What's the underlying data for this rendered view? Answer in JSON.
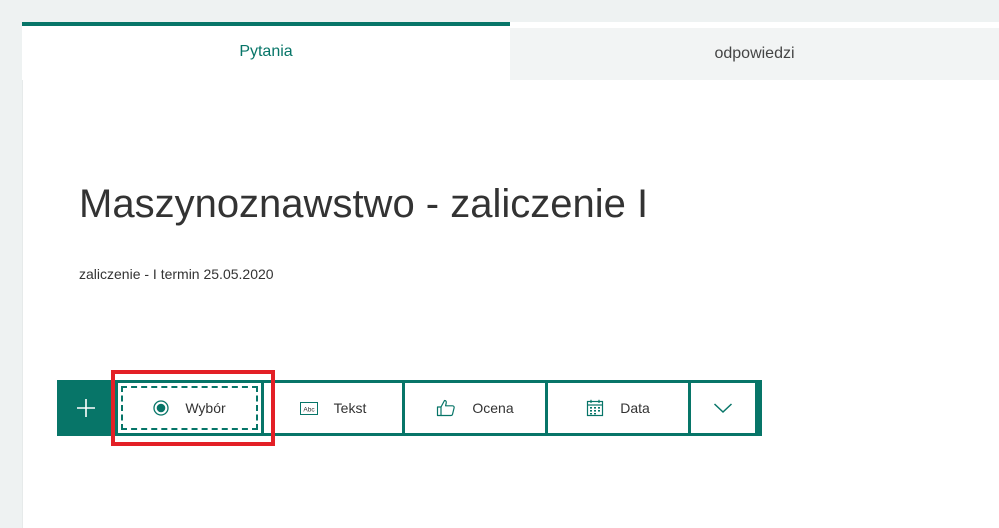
{
  "tabs": {
    "questions": "Pytania",
    "responses": "odpowiedzi"
  },
  "form": {
    "title": "Maszynoznawstwo - zaliczenie I",
    "subtitle": "zaliczenie - I termin 25.05.2020"
  },
  "toolbar": {
    "add_icon": "plus-icon",
    "items": [
      {
        "label": "Wybór",
        "icon": "radio-button-icon"
      },
      {
        "label": "Tekst",
        "icon": "text-abc-icon"
      },
      {
        "label": "Ocena",
        "icon": "thumbs-up-icon"
      },
      {
        "label": "Data",
        "icon": "calendar-icon"
      }
    ],
    "more_icon": "chevron-down-icon",
    "abc_glyph": "Abc"
  },
  "colors": {
    "accent": "#077568",
    "highlight": "#e32026",
    "background": "#eef2f2"
  }
}
